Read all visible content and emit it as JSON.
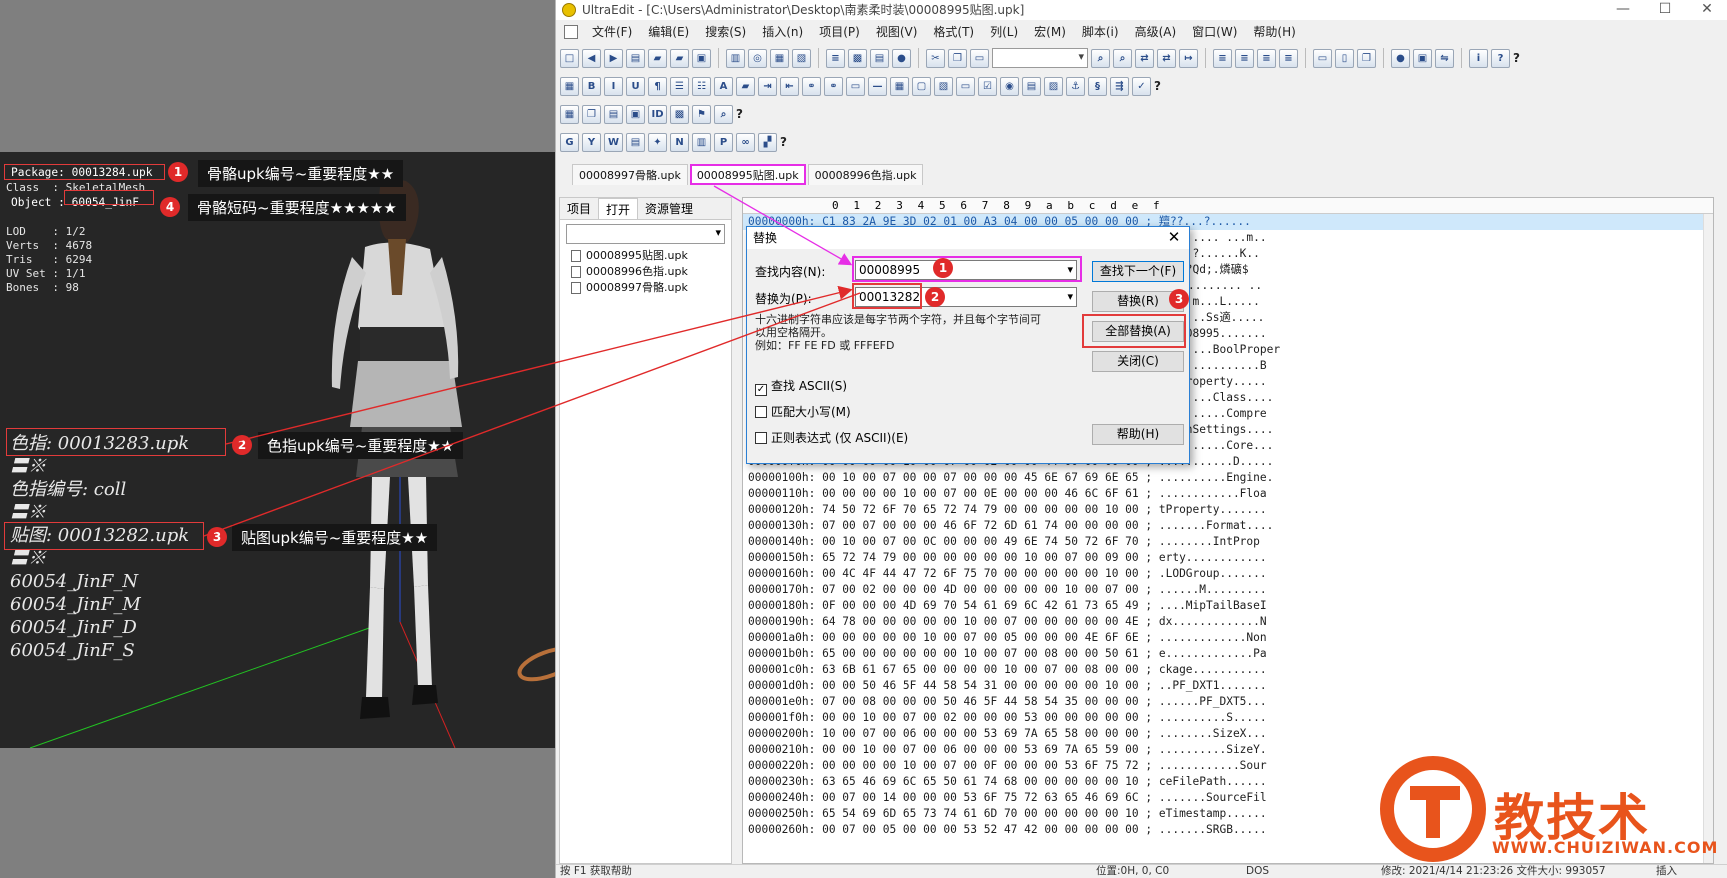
{
  "viewer": {
    "info_rows": [
      "Package: 00013284.upk",
      "Class  : SkeletalMesh",
      "Object : 60054_JinF",
      "",
      "LOD    : 1/2",
      "Verts  : 4678",
      "Tris   : 6294",
      "UV Set : 1/1",
      "Bones  : 98"
    ],
    "texture_list": [
      "色指: 00013283.upk",
      "〓※",
      "色指编号: coll",
      "〓※",
      "贴图: 00013282.upk",
      "〓※",
      "60054_JinF_N",
      "60054_JinF_M",
      "60054_JinF_D",
      "60054_JinF_S"
    ],
    "callouts": [
      {
        "num": "1",
        "text": "骨骼upk编号~重要程度★★"
      },
      {
        "num": "4",
        "text": "骨骼短码~重要程度★★★★★"
      },
      {
        "num": "2",
        "text": "色指upk编号~重要程度★★"
      },
      {
        "num": "3",
        "text": "贴图upk编号~重要程度★★"
      }
    ]
  },
  "window": {
    "title": "UltraEdit - [C:\\Users\\Administrator\\Desktop\\南素柔时装\\00008995贴图.upk]",
    "menu": [
      "文件(F)",
      "编辑(E)",
      "搜索(S)",
      "插入(n)",
      "项目(P)",
      "视图(V)",
      "格式(T)",
      "列(L)",
      "宏(M)",
      "脚本(i)",
      "高级(A)",
      "窗口(W)",
      "帮助(H)"
    ],
    "file_tabs": [
      "00008997骨骼.upk",
      "00008995贴图.upk",
      "00008996色指.upk"
    ],
    "panel": {
      "tabs": [
        "项目",
        "打开",
        "资源管理"
      ],
      "files": [
        "00008995贴图.upk",
        "00008996色指.upk",
        "00008997骨骼.upk"
      ]
    },
    "ruler": [
      "0",
      "1",
      "2",
      "3",
      "4",
      "5",
      "6",
      "7",
      "8",
      "9",
      "a",
      "b",
      "c",
      "d",
      "e",
      "f"
    ],
    "hex_rows": [
      "00000000h: C1 83 2A 9E 3D 02 01 00 A3 04 00 00 05 00 00 00 ; 羶??...?......",
      "00000010h: 4E 6F 6E 65 00 00 00 00 00 00 00 00 00 00 00 00 ; None..... ...m..",
      "00000020h: 00 00 00 00 00 00 00 00 00 00 00 00 00 00 00 00 ; .....?......K..",
      "00000030h: 00 00 00 00 00 00 00 00 00 00 00 00 00 00 00 24 ; .?..?Qd;.燐礦$",
      "00000040h: 00 00 00 00 00 00 00 00 00 00 00 00 00 00 00 00 ; %罐僊........ ..",
      "00000050h: 00 00 00 00 00 00 00 00 00 00 00 00 00 00 00 00 ; .....m...L.....",
      "00000060h: 00 00 00 00 00 00 00 00 00 00 00 00 00 00 00 00 ; .......Ss適.....",
      "00000070h: 00 00 00 00 00 00 00 00 00 00 00 00 00 00 00 00 ; .00008995.......",
      "00000080h: 00 00 00 00 00 00 00 00 00 00 00 00 00 00 00 72 ; ........BoolProper",
      "00000090h: 00 00 00 00 00 00 00 00 00 00 00 00 00 00 00 42 ; ty.............B",
      "000000a0h: 00 00 00 00 00 00 00 00 00 00 00 00 00 00 00 00 ; yteProperty.....",
      "000000b0h: 00 00 00 00 00 00 00 00 00 00 00 00 00 00 00 00 ; ........Class....",
      "000000c0h: 00 00 00 00 00 00 00 00 00 00 00 00 00 00 00 65 ; ..........Compre",
      "000000d0h: 00 00 00 00 00 00 00 00 00 00 00 00 00 00 00 00 ; ssionSettings....",
      "000000e0h: 00 00 00 00 00 00 00 00 00 00 00 00 00 00 00 00 ; ..........Core...",
      "000000f0h: 00 00 00 00 10 00 07 00 02 00 00 44 00 00 00 00 ; ...........D.....",
      "00000100h: 00 10 00 07 00 00 07 00 00 00 45 6E 67 69 6E 65 ; ..........Engine.",
      "00000110h: 00 00 00 00 10 00 07 00 0E 00 00 00 46 6C 6F 61 ; ............Floa",
      "00000120h: 74 50 72 6F 70 65 72 74 79 00 00 00 00 00 10 00 ; tProperty.......",
      "00000130h: 07 00 07 00 00 00 46 6F 72 6D 61 74 00 00 00 00 ; .......Format....",
      "00000140h: 00 10 00 07 00 0C 00 00 00 49 6E 74 50 72 6F 70 ; ........IntProp",
      "00000150h: 65 72 74 79 00 00 00 00 00 00 10 00 07 00 09 00 ; erty............",
      "00000160h: 00 4C 4F 44 47 72 6F 75 70 00 00 00 00 00 10 00 ; .LODGroup.......",
      "00000170h: 07 00 02 00 00 00 4D 00 00 00 00 00 10 00 07 00 ; ......M.........",
      "00000180h: 0F 00 00 00 4D 69 70 54 61 69 6C 42 61 73 65 49 ; ....MipTailBaseI",
      "00000190h: 64 78 00 00 00 00 00 10 00 07 00 00 00 00 00 4E ; dx.............N",
      "000001a0h: 00 00 00 00 00 10 00 07 00 05 00 00 00 4E 6F 6E ; .............Non",
      "000001b0h: 65 00 00 00 00 00 00 10 00 07 00 08 00 00 50 61 ; e.............Pa",
      "000001c0h: 63 6B 61 67 65 00 00 00 00 10 00 07 00 08 00 00 ; ckage...........",
      "000001d0h: 00 00 50 46 5F 44 58 54 31 00 00 00 00 00 10 00 ; ..PF_DXT1.......",
      "000001e0h: 07 00 08 00 00 00 50 46 5F 44 58 54 35 00 00 00 ; ......PF_DXT5...",
      "000001f0h: 00 00 10 00 07 00 02 00 00 00 53 00 00 00 00 00 ; ..........S.....",
      "00000200h: 10 00 07 00 06 00 00 00 53 69 7A 65 58 00 00 00 ; ........SizeX...",
      "00000210h: 00 00 10 00 07 00 06 00 00 00 53 69 7A 65 59 00 ; ..........SizeY.",
      "00000220h: 00 00 00 00 10 00 07 00 0F 00 00 00 53 6F 75 72 ; ............Sour",
      "00000230h: 63 65 46 69 6C 65 50 61 74 68 00 00 00 00 00 10 ; ceFilePath......",
      "00000240h: 00 07 00 14 00 00 00 53 6F 75 72 63 65 46 69 6C ; .......SourceFil",
      "00000250h: 65 54 69 6D 65 73 74 61 6D 70 00 00 00 00 00 10 ; eTimestamp......",
      "00000260h: 00 07 00 05 00 00 00 53 52 47 42 00 00 00 00 00 ; .......SRGB....."
    ],
    "status": {
      "help": "按 F1 获取帮助",
      "pos": "位置:0H, 0, C0",
      "fmt": "DOS",
      "mod": "修改: 2021/4/14 21:23:26  文件大小: 993057",
      "mode": "插入"
    }
  },
  "dialog": {
    "title": "替换",
    "find_label": "查找内容(N):",
    "find_value": "00008995",
    "replace_label": "替换为(P):",
    "replace_value": "00013282",
    "hint": "十六进制字符串应该是每字节两个字符，并且每个字节间可\n以用空格隔开。\n例如：FF FE FD 或 FFFEFD",
    "find_next": "查找下一个(F)",
    "replace": "替换(R)",
    "replace_all": "全部替换(A)",
    "close": "关闭(C)",
    "help": "帮助(H)",
    "check_ascii": "查找 ASCII(S)",
    "check_case": "匹配大小写(M)",
    "check_regex": "正则表达式 (仅 ASCII)(E)",
    "badges": [
      "1",
      "2",
      "3"
    ]
  },
  "watermark": {
    "text": "教技术",
    "url": "WWW.CHUIZIWAN.COM"
  },
  "colors": {
    "annotation_red": "#e02a2a",
    "annotation_magenta": "#e62ee6",
    "watermark_orange": "#e8541c"
  }
}
